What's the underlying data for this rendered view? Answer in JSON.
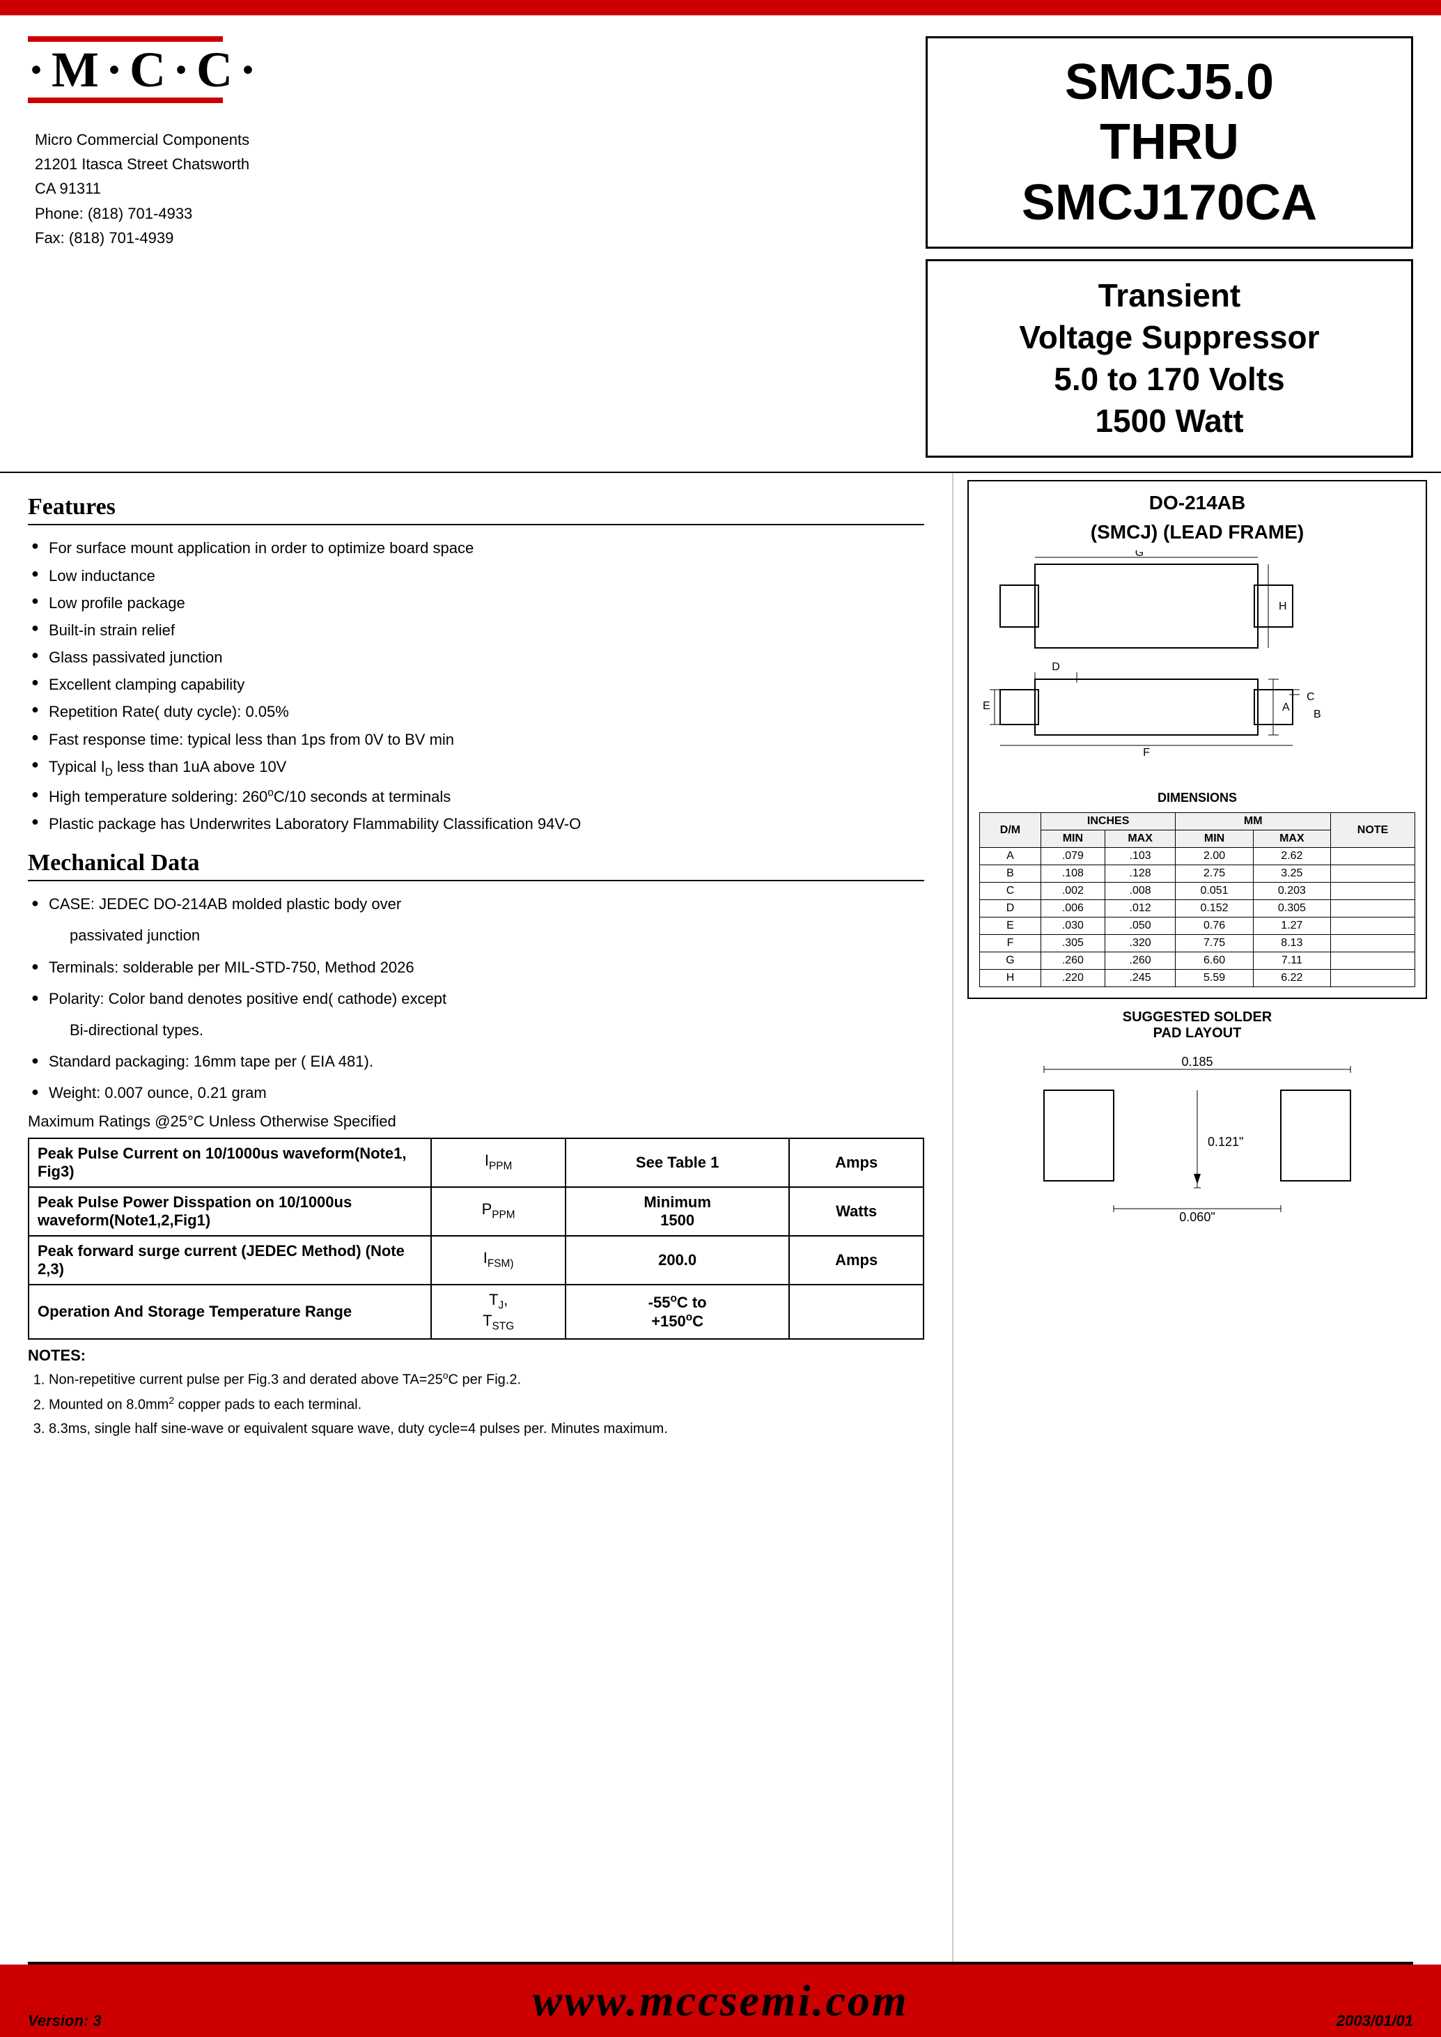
{
  "header": {
    "logo_text": "·M·C·C·",
    "company_name": "Micro Commercial Components",
    "company_address1": "21201 Itasca Street Chatsworth",
    "company_address2": "CA 91311",
    "company_phone": "Phone:  (818) 701-4933",
    "company_fax": "Fax:    (818) 701-4939",
    "part_number": "SMCJ5.0\nTHRU\nSMCJ170CA",
    "description_line1": "Transient",
    "description_line2": "Voltage Suppressor",
    "description_line3": "5.0 to 170 Volts",
    "description_line4": "1500 Watt"
  },
  "features": {
    "title": "Features",
    "items": [
      "For surface mount application in order to optimize board space",
      "Low inductance",
      "Low profile package",
      "Built-in strain relief",
      "Glass passivated junction",
      "Excellent clamping capability",
      "Repetition Rate( duty cycle): 0.05%",
      "Fast response time: typical less than 1ps from 0V to BV min",
      "Typical I₀ less than 1uA above 10V",
      "High temperature soldering: 260°C/10 seconds at terminals",
      "Plastic package has Underwrites Laboratory Flammability Classification 94V-O"
    ]
  },
  "mechanical": {
    "title": "Mechanical Data",
    "items": [
      {
        "text": "CASE: JEDEC DO-214AB molded plastic body over",
        "indent": "passivated junction"
      },
      {
        "text": "Terminals:  solderable per MIL-STD-750, Method 2026"
      },
      {
        "text": "Polarity: Color band denotes positive end( cathode) except",
        "indent": "Bi-directional types."
      },
      {
        "text": "Standard packaging: 16mm tape per ( EIA 481)."
      },
      {
        "text": "Weight: 0.007 ounce, 0.21 gram"
      }
    ]
  },
  "max_ratings_label": "Maximum Ratings @25°C Unless Otherwise Specified",
  "ratings_table": [
    {
      "label": "Peak Pulse Current on 10/1000us waveform(Note1, Fig3)",
      "symbol": "IPPM",
      "value": "See Table 1",
      "unit": "Amps"
    },
    {
      "label": "Peak Pulse Power Disspation on 10/1000us waveform(Note1,2,Fig1)",
      "symbol": "PPPM",
      "value": "Minimum\n1500",
      "unit": "Watts"
    },
    {
      "label": "Peak forward surge current (JEDEC Method) (Note 2,3)",
      "symbol": "IFSM)",
      "value": "200.0",
      "unit": "Amps"
    },
    {
      "label": "Operation And Storage Temperature Range",
      "symbol": "TJ,\nTSTG",
      "value": "-55°C to\n+150°C",
      "unit": ""
    }
  ],
  "notes": {
    "title": "NOTES:",
    "items": [
      "Non-repetitive current pulse per Fig.3 and derated above TA=25°C per Fig.2.",
      "Mounted on 8.0mm² copper pads to each terminal.",
      "8.3ms, single half sine-wave or equivalent square wave, duty cycle=4 pulses per. Minutes maximum."
    ]
  },
  "package": {
    "title1": "DO-214AB",
    "title2": "(SMCJ) (LEAD FRAME)"
  },
  "dimensions_table": {
    "headers": [
      "D/M",
      "MIN",
      "MAX",
      "MIN",
      "MAX",
      "NOTE"
    ],
    "subheaders": [
      "",
      "INCHES",
      "",
      "MM",
      "",
      ""
    ],
    "rows": [
      [
        "A",
        ".079",
        ".103",
        "2.00",
        "2.62",
        ""
      ],
      [
        "B",
        ".108",
        ".128",
        "2.75",
        "3.25",
        ""
      ],
      [
        "C",
        ".002",
        ".008",
        "0.051",
        "0.203",
        ""
      ],
      [
        "D",
        ".006",
        ".012",
        "0.152",
        "0.305",
        ""
      ],
      [
        "E",
        ".030",
        ".050",
        "0.76",
        "1.27",
        ""
      ],
      [
        "F",
        ".305",
        ".320",
        "7.75",
        "8.13",
        ""
      ],
      [
        "G",
        ".260",
        ".260",
        "6.60",
        "7.11",
        ""
      ],
      [
        "H",
        ".220",
        ".245",
        "5.59",
        "6.22",
        ""
      ]
    ]
  },
  "solder_pad": {
    "title": "SUGGESTED SOLDER PAD LAYOUT",
    "dim1": "0.185",
    "dim2": "0.121\"",
    "dim3": "0.060\""
  },
  "footer": {
    "url": "www.mccsemi.com",
    "version": "Version: 3",
    "date": "2003/01/01"
  }
}
